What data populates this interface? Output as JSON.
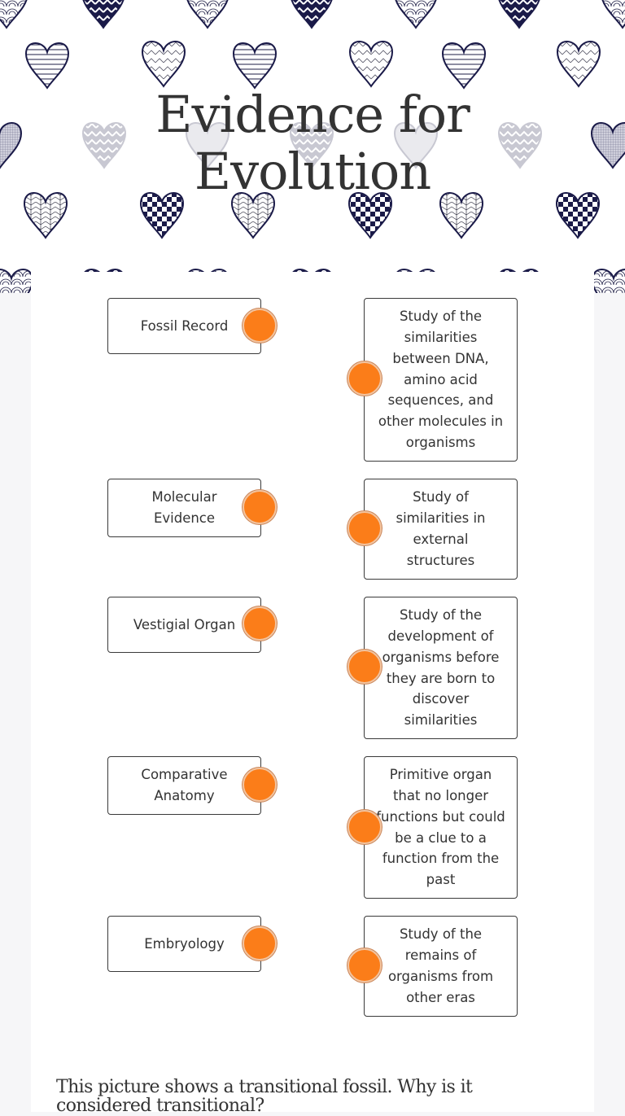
{
  "worksheet": {
    "title_line1": "Evidence for",
    "title_line2": "Evolution",
    "accent_color": "#fb7d19",
    "header_pattern": "hearts-navy-doodle"
  },
  "matching": {
    "terms": [
      {
        "label": "Fossil Record"
      },
      {
        "label": "Molecular Evidence"
      },
      {
        "label": "Vestigial Organ"
      },
      {
        "label": "Comparative Anatomy"
      },
      {
        "label": "Embryology"
      }
    ],
    "definitions": [
      {
        "label": "Study of the similarities between DNA, amino acid sequences, and other molecules in organisms"
      },
      {
        "label": "Study of similarities in external structures"
      },
      {
        "label": "Study of the development of organisms before they are born to discover similarities"
      },
      {
        "label": "Primitive organ that no longer functions but could be a clue to a function from the past"
      },
      {
        "label": "Study of the remains of organisms from other eras"
      }
    ]
  },
  "question": {
    "text": "This picture shows a transitional fossil.  Why is it considered transitional?"
  }
}
